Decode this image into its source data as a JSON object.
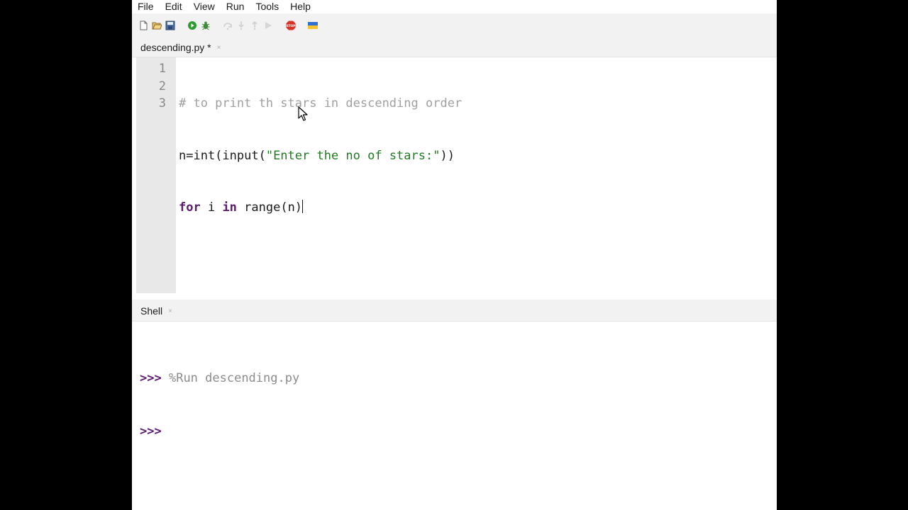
{
  "menu": [
    "File",
    "Edit",
    "View",
    "Run",
    "Tools",
    "Help"
  ],
  "toolbar": {
    "icons": [
      "new-file-icon",
      "open-file-icon",
      "save-icon",
      "run-icon",
      "debug-icon",
      "step-over-icon",
      "step-into-icon",
      "step-out-icon",
      "resume-icon",
      "stop-icon",
      "ukraine-flag-icon"
    ],
    "colors": {
      "run": "#2e9b2e",
      "stop": "#d93025",
      "flag_top": "#2f6fd6",
      "flag_bottom": "#f4c430"
    }
  },
  "editor": {
    "tab_label": "descending.py *",
    "tab_close": "×",
    "line_numbers": [
      "1",
      "2",
      "3"
    ],
    "lines": {
      "l1_comment": "# to print th stars in descending order",
      "l2_a": "n=int(input(",
      "l2_string": "\"Enter the no of stars:\"",
      "l2_b": "))",
      "l3_kw_for": "for",
      "l3_a": " i ",
      "l3_kw_in": "in",
      "l3_b": " range(n)"
    }
  },
  "shell": {
    "tab_label": "Shell",
    "tab_close": "×",
    "prompt": ">>>",
    "command": "%Run descending.py"
  }
}
